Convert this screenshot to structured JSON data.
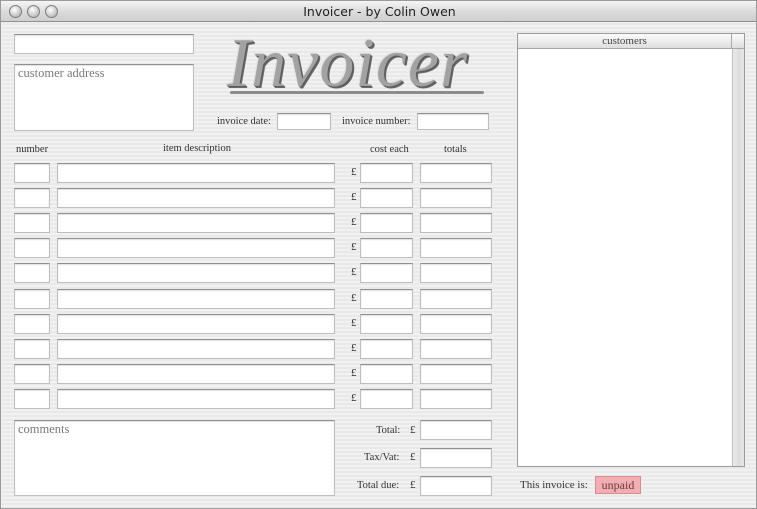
{
  "window": {
    "title": "Invoicer - by Colin Owen"
  },
  "header": {
    "logo_text": "Invoicer",
    "customer_address_placeholder": "customer address",
    "invoice_date_label": "invoice date:",
    "invoice_number_label": "invoice number:"
  },
  "columns": {
    "number": "number",
    "item_description": "item description",
    "cost_each": "cost each",
    "totals": "totals"
  },
  "line_items": {
    "currency_symbol": "£",
    "rows": [
      {
        "number": "",
        "description": "",
        "cost": "",
        "total": ""
      },
      {
        "number": "",
        "description": "",
        "cost": "",
        "total": ""
      },
      {
        "number": "",
        "description": "",
        "cost": "",
        "total": ""
      },
      {
        "number": "",
        "description": "",
        "cost": "",
        "total": ""
      },
      {
        "number": "",
        "description": "",
        "cost": "",
        "total": ""
      },
      {
        "number": "",
        "description": "",
        "cost": "",
        "total": ""
      },
      {
        "number": "",
        "description": "",
        "cost": "",
        "total": ""
      },
      {
        "number": "",
        "description": "",
        "cost": "",
        "total": ""
      },
      {
        "number": "",
        "description": "",
        "cost": "",
        "total": ""
      },
      {
        "number": "",
        "description": "",
        "cost": "",
        "total": ""
      }
    ]
  },
  "comments": {
    "placeholder": "comments"
  },
  "summary": {
    "total_label": "Total:",
    "tax_label": "Tax/Vat:",
    "total_due_label": "Total due:",
    "currency_symbol": "£"
  },
  "customers": {
    "header": "customers"
  },
  "status": {
    "label": "This invoice is:",
    "value": "unpaid",
    "badge_color": "#f2aeb2"
  }
}
